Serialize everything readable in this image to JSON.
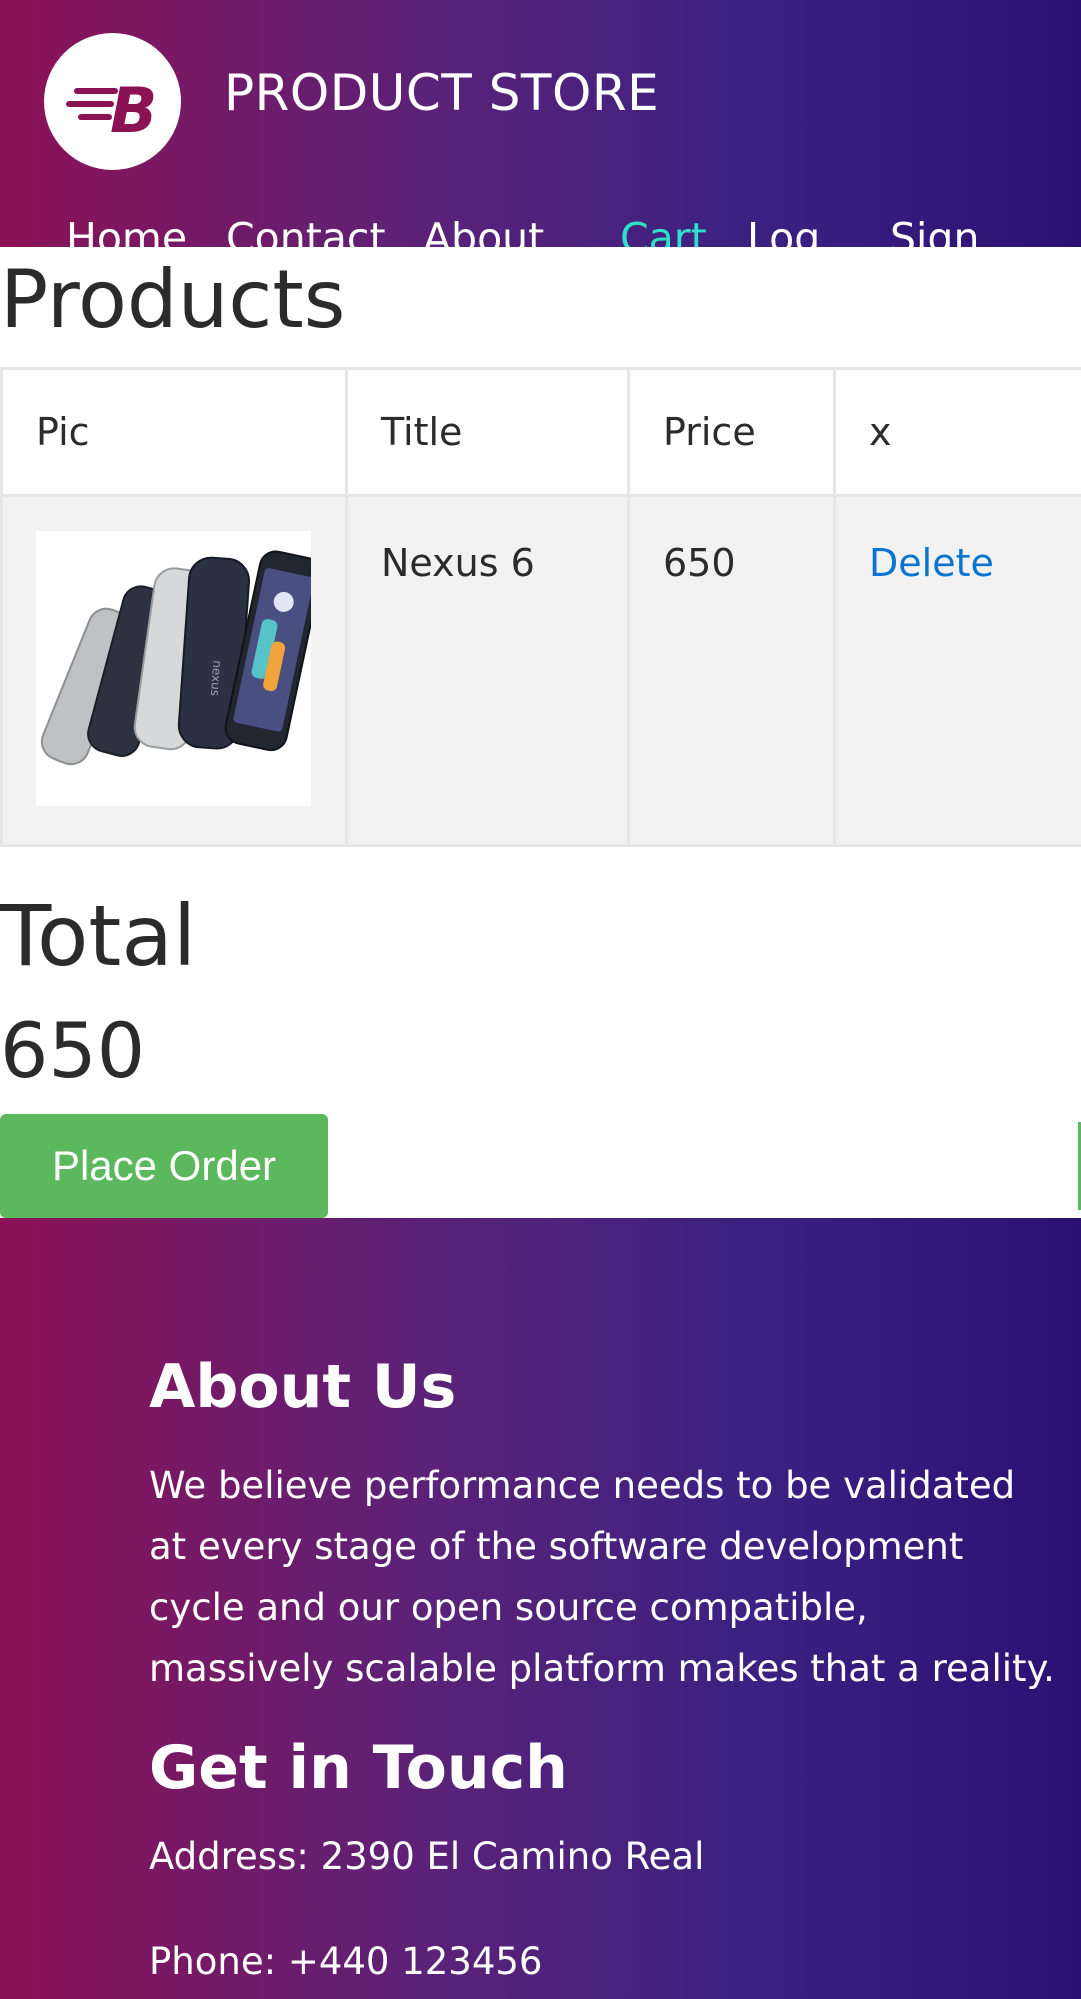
{
  "header": {
    "brand": "PRODUCT STORE",
    "nav": [
      "Home",
      "Contact",
      "About",
      "Cart",
      "Log",
      "Sign"
    ],
    "active_nav": "Cart"
  },
  "main": {
    "title": "Products",
    "table": {
      "headers": [
        "Pic",
        "Title",
        "Price",
        "x"
      ],
      "rows": [
        {
          "title": "Nexus 6",
          "price": "650",
          "action": "Delete"
        }
      ]
    },
    "total_label": "Total",
    "total_value": "650",
    "place_order": "Place Order"
  },
  "footer": {
    "about_title": "About Us",
    "about_text": "We believe performance needs to be validated at every stage of the software development cycle and our open source compatible, massively scalable platform makes that a reality.",
    "contact_title": "Get in Touch",
    "address": "Address: 2390 El Camino Real",
    "phone": "Phone: +440 123456"
  },
  "colors": {
    "gradient_start": "#8c1256",
    "gradient_end": "#2a1173",
    "active_nav": "#2fe0c8",
    "link": "#0a74d1",
    "button": "#5cb85c"
  },
  "icons": {
    "logo": "speed-b-logo-icon"
  }
}
